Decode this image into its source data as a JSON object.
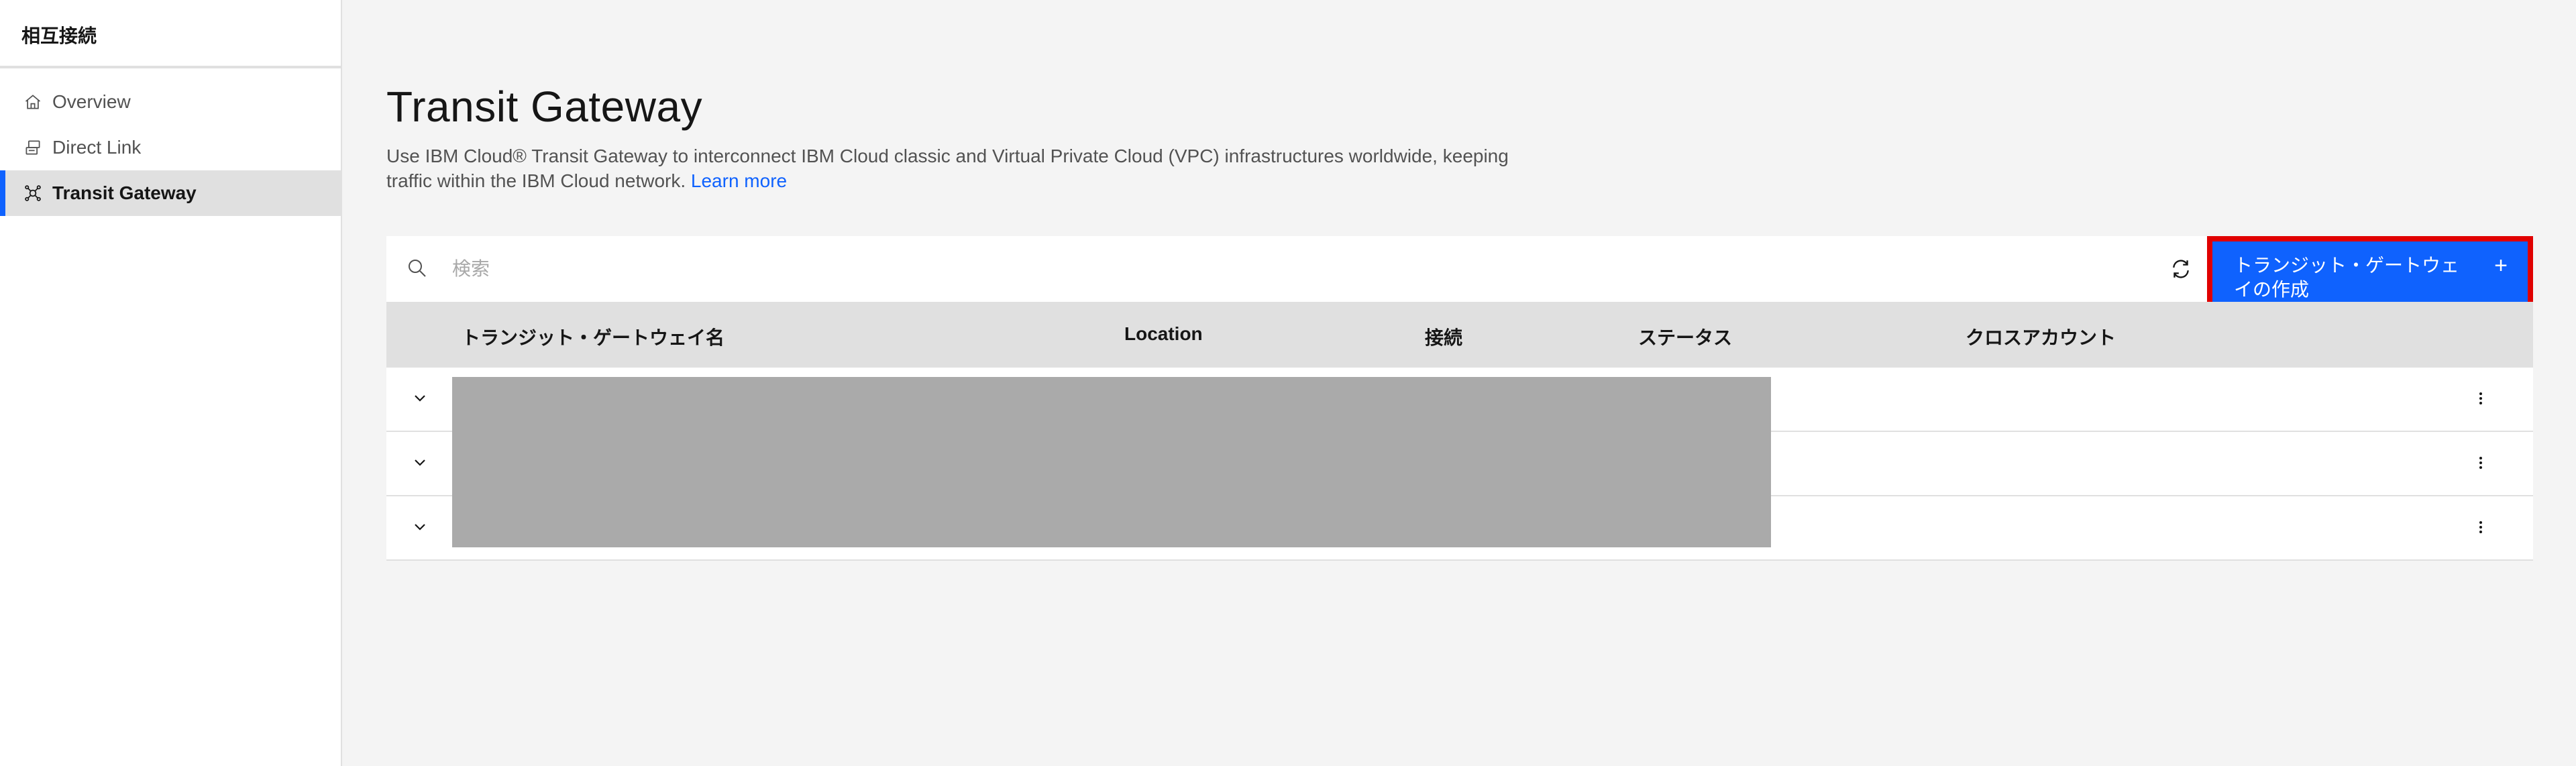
{
  "sidebar": {
    "title": "相互接続",
    "items": [
      {
        "label": "Overview",
        "icon": "home-icon",
        "active": false
      },
      {
        "label": "Direct Link",
        "icon": "direct-link-icon",
        "active": false
      },
      {
        "label": "Transit Gateway",
        "icon": "transit-gateway-icon",
        "active": true
      }
    ]
  },
  "main": {
    "title": "Transit Gateway",
    "description": "Use IBM Cloud® Transit Gateway to interconnect IBM Cloud classic and Virtual Private Cloud (VPC) infrastructures worldwide, keeping traffic within the IBM Cloud network.",
    "learn_more": "Learn more",
    "search": {
      "placeholder": "検索"
    },
    "create_button": {
      "label": "トランジット・ゲートウェイの作成",
      "icon": "plus"
    },
    "table": {
      "columns": [
        "トランジット・ゲートウェイ名",
        "Location",
        "接続",
        "ステータス",
        "クロスアカウント"
      ],
      "rows": [
        {
          "redacted": true
        },
        {
          "redacted": true
        },
        {
          "redacted": true
        }
      ]
    }
  },
  "colors": {
    "accent": "#0f62fe",
    "highlight": "#e00000",
    "redaction": "#aaaaaa"
  }
}
